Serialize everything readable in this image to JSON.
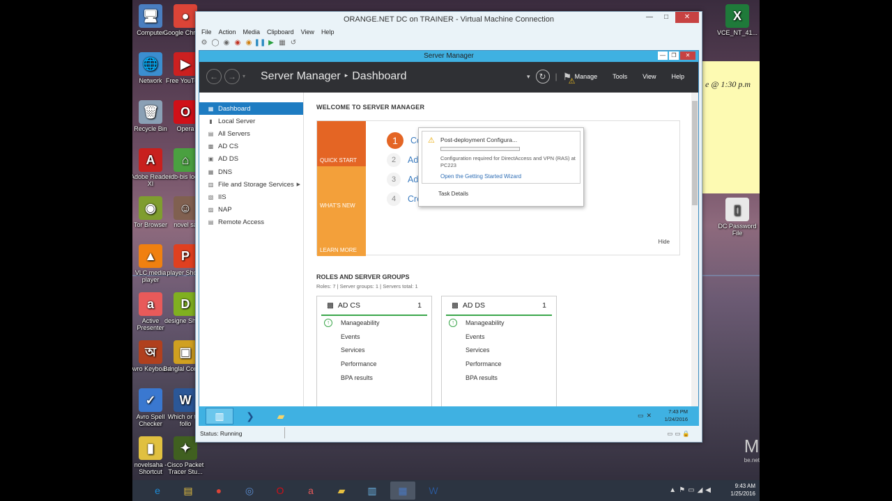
{
  "desktop": {
    "icons_left": [
      {
        "label": "Computer",
        "glyph": "🖥",
        "color": "#4a7ec0"
      },
      {
        "label": "Network",
        "glyph": "🌐",
        "color": "#3b8ed0"
      },
      {
        "label": "Recycle Bin",
        "glyph": "🗑",
        "color": "#8aa0b5"
      },
      {
        "label": "Adobe Reader XI",
        "glyph": "A",
        "color": "#c8201e"
      },
      {
        "label": "Tor Browser",
        "glyph": "◉",
        "color": "#7f9d2f"
      },
      {
        "label": "VLC media player",
        "glyph": "▲",
        "color": "#f08010"
      },
      {
        "label": "Active Presenter",
        "glyph": "a",
        "color": "#e85a5a"
      },
      {
        "label": "Avro Keyboard",
        "glyph": "অ",
        "color": "#b0401e"
      },
      {
        "label": "Avro Spell Checker",
        "glyph": "✓",
        "color": "#3a78d0"
      },
      {
        "label": "novelsaha - Shortcut",
        "glyph": "▮",
        "color": "#e0c040"
      }
    ],
    "icons_right_col": [
      {
        "label": "Google Chrome",
        "glyph": "●",
        "color": "#db4437"
      },
      {
        "label": "Free YouTube",
        "glyph": "▶",
        "color": "#cc2020"
      },
      {
        "label": "Opera",
        "glyph": "O",
        "color": "#d01018"
      },
      {
        "label": "idb-bis logo",
        "glyph": "⌂",
        "color": "#4aa040"
      },
      {
        "label": "novel sa",
        "glyph": "☺",
        "color": "#806050"
      },
      {
        "label": "player Shortc",
        "glyph": "P",
        "color": "#e04020"
      },
      {
        "label": "designe Shortc",
        "glyph": "D",
        "color": "#80b020"
      },
      {
        "label": "Banglal Connec",
        "glyph": "▣",
        "color": "#d0a020"
      },
      {
        "label": "Which or the follo",
        "glyph": "W",
        "color": "#2b5797"
      },
      {
        "label": "Cisco Packet Tracer Stu...",
        "glyph": "✦",
        "color": "#406020"
      }
    ],
    "far_right": [
      {
        "label": "VCE_NT_41...",
        "glyph": "X",
        "color": "#1f7a3a"
      },
      {
        "label": "DC Password File",
        "glyph": "▯",
        "color": "#e8e8e8"
      }
    ],
    "sticky_note": "e @ 1:30 p.m",
    "watermark": "M",
    "watermark_sub": "be.net",
    "taskbar": {
      "items": [
        {
          "name": "ie-icon",
          "glyph": "e",
          "color": "#1d8cd8"
        },
        {
          "name": "explorer-icon",
          "glyph": "▤",
          "color": "#e8c040"
        },
        {
          "name": "chrome-icon",
          "glyph": "●",
          "color": "#db4437"
        },
        {
          "name": "circle-app-icon",
          "glyph": "◎",
          "color": "#5a8cd0"
        },
        {
          "name": "opera-icon",
          "glyph": "O",
          "color": "#d01018"
        },
        {
          "name": "active-presenter-icon",
          "glyph": "a",
          "color": "#e85a5a"
        },
        {
          "name": "folder-icon",
          "glyph": "▰",
          "color": "#e8c040"
        },
        {
          "name": "server-icon",
          "glyph": "▥",
          "color": "#6ab0e0"
        },
        {
          "name": "vm-connection-icon",
          "glyph": "▦",
          "color": "#4a78c0"
        },
        {
          "name": "word-icon",
          "glyph": "W",
          "color": "#2b5797"
        }
      ],
      "time": "9:43 AM",
      "date": "1/25/2016"
    }
  },
  "vm": {
    "title": "ORANGE.NET DC on TRAINER - Virtual Machine Connection",
    "menu": [
      "File",
      "Action",
      "Media",
      "Clipboard",
      "View",
      "Help"
    ],
    "status": "Status: Running",
    "taskbar_time": "7:43 PM",
    "taskbar_date": "1/24/2016"
  },
  "server_manager": {
    "window_title": "Server Manager",
    "breadcrumb_app": "Server Manager",
    "breadcrumb_page": "Dashboard",
    "menu": [
      "Manage",
      "Tools",
      "View",
      "Help"
    ],
    "sidebar": [
      {
        "label": "Dashboard",
        "icon": "▦",
        "selected": true
      },
      {
        "label": "Local Server",
        "icon": "▮"
      },
      {
        "label": "All Servers",
        "icon": "▤"
      },
      {
        "label": "AD CS",
        "icon": "▩"
      },
      {
        "label": "AD DS",
        "icon": "▣"
      },
      {
        "label": "DNS",
        "icon": "▦"
      },
      {
        "label": "File and Storage Services",
        "icon": "▥",
        "arrow": "▶"
      },
      {
        "label": "IIS",
        "icon": "▧"
      },
      {
        "label": "NAP",
        "icon": "▨"
      },
      {
        "label": "Remote Access",
        "icon": "▤"
      }
    ],
    "welcome": "WELCOME TO SERVER MANAGER",
    "tiles": {
      "quick_start": "QUICK START",
      "whats_new": "WHAT'S NEW",
      "learn_more": "LEARN MORE"
    },
    "steps": [
      {
        "num": "1",
        "label": "Configure this local server"
      },
      {
        "num": "2",
        "label": "Add roles and features"
      },
      {
        "num": "3",
        "label": "Add other servers to manage"
      },
      {
        "num": "4",
        "label": "Create a server group"
      }
    ],
    "hide": "Hide",
    "roles_heading": "ROLES AND SERVER GROUPS",
    "roles_sub": "Roles: 7   |   Server groups: 1   |   Servers total: 1",
    "cards": [
      {
        "title": "AD CS",
        "count": "1",
        "rows": [
          "Manageability",
          "Events",
          "Services",
          "Performance",
          "BPA results"
        ]
      },
      {
        "title": "AD DS",
        "count": "1",
        "rows": [
          "Manageability",
          "Events",
          "Services",
          "Performance",
          "BPA results"
        ]
      }
    ],
    "notification": {
      "title": "Post-deployment Configura...",
      "desc": "Configuration required for DirectAccess and VPN (RAS) at PC223",
      "link": "Open the Getting Started Wizard",
      "task_details": "Task Details"
    }
  }
}
